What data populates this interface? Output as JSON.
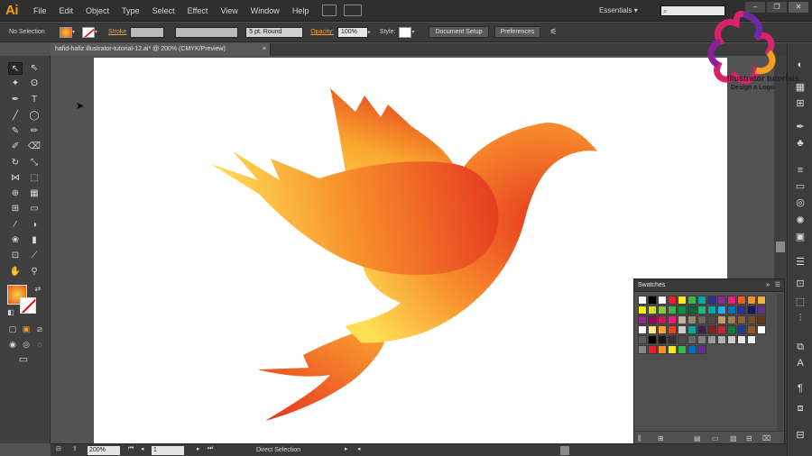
{
  "app": {
    "logo_text": "Ai",
    "menus": [
      "File",
      "Edit",
      "Object",
      "Type",
      "Select",
      "Effect",
      "View",
      "Window",
      "Help"
    ],
    "workspace": "Essentials",
    "search_icon": "search-icon",
    "window_controls": [
      "–",
      "❐",
      "✕"
    ]
  },
  "control_bar": {
    "selection_label": "No Selection",
    "stroke_label": "Stroke",
    "brush": "5 pt. Round",
    "opacity_label": "Opacity:",
    "opacity_value": "100%",
    "style_label": "Style:",
    "document_setup": "Document Setup",
    "preferences": "Preferences"
  },
  "document": {
    "tab_title": "hafid-hafiz illustrator-tutorial-12.ai* @ 200% (CMYK/Preview)",
    "close": "×"
  },
  "status_bar": {
    "zoom": "200%",
    "page": "1",
    "tool": "Direct Selection"
  },
  "swatches_panel": {
    "title": "Swatches",
    "menu_icon": "panel-menu-icon"
  },
  "watermark": {
    "line1": "Illustrator tutorials",
    "line2": "Design a Logo"
  },
  "colors": {
    "brand_orange": "#f49d1e",
    "art_light": "#ffe057",
    "art_mid": "#f7922a",
    "art_dark": "#e63a22"
  }
}
